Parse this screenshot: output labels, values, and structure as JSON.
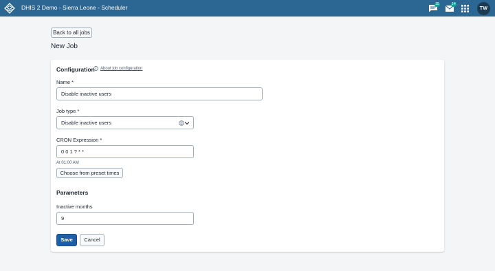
{
  "header": {
    "app_title": "DHIS 2 Demo - Sierra Leone - Scheduler",
    "icons": [
      "dhis2-logo-icon",
      "messages-icon",
      "email-icon",
      "apps-grid-icon"
    ],
    "messages_badge": "15",
    "email_badge": "14",
    "avatar_initials": "TW",
    "colors": {
      "bar": "#2c6693",
      "badge": "#04a89b",
      "avatar": "#1b3a52"
    }
  },
  "page": {
    "back_label": "Back to all jobs",
    "title": "New Job"
  },
  "form": {
    "configuration_title": "Configuration",
    "about_link": "About job configuration",
    "name_label": "Name *",
    "name_value": "Disable inactive users",
    "job_type_label": "Job type *",
    "job_type_value": "Disable inactive users",
    "cron_label": "CRON Expression *",
    "cron_value": "0 0 1 ? * *",
    "cron_help": "At 01:00 AM",
    "preset_label": "Choose from preset times",
    "parameters_title": "Parameters",
    "inactive_months_label": "Inactive months",
    "inactive_months_value": "9",
    "save_label": "Save",
    "cancel_label": "Cancel",
    "primary_color": "#1c5fa8"
  }
}
